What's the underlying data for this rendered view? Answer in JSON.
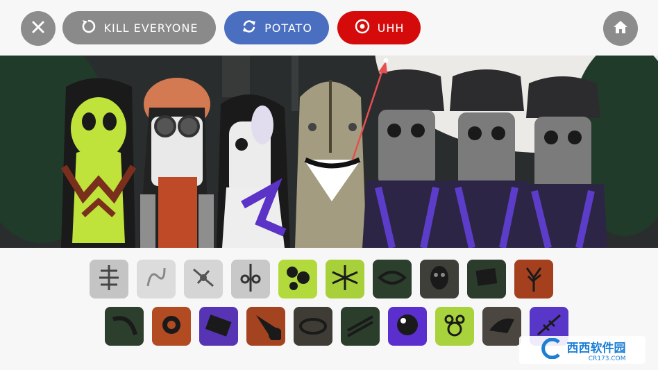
{
  "topbar": {
    "close_icon": "close-icon",
    "buttons": [
      {
        "label": "KILL EVERYONE",
        "icon": "reload-icon",
        "color": "#8a8a8a"
      },
      {
        "label": "POTATO",
        "icon": "refresh-icon",
        "color": "#4a6fc1"
      },
      {
        "label": "UHH",
        "icon": "record-icon",
        "color": "#d50a0a"
      }
    ],
    "home_icon": "home-icon"
  },
  "stage": {
    "characters": [
      {
        "name": "green-skeleton"
      },
      {
        "name": "brain-head"
      },
      {
        "name": "white-hair"
      },
      {
        "name": "burlap-sack"
      },
      {
        "name": "purple-hood-1"
      },
      {
        "name": "purple-hood-2"
      },
      {
        "name": "purple-hood-3"
      }
    ]
  },
  "palette": {
    "row1": [
      {
        "icon": "spine-icon",
        "bg": "#c4c4c4"
      },
      {
        "icon": "scribble-icon",
        "bg": "#dcdcdc"
      },
      {
        "icon": "dancer-icon",
        "bg": "#d5d5d5"
      },
      {
        "icon": "totem-icon",
        "bg": "#c8c8c8"
      },
      {
        "icon": "blob-icon",
        "bg": "#b2da3c"
      },
      {
        "icon": "tangle-icon",
        "bg": "#a8d03a"
      },
      {
        "icon": "eye-icon",
        "bg": "#2b3f2c"
      },
      {
        "icon": "mask-icon",
        "bg": "#3f3f3a"
      },
      {
        "icon": "box-icon",
        "bg": "#2c3c2c"
      },
      {
        "icon": "tree-icon",
        "bg": "#a5401f"
      }
    ],
    "row2": [
      {
        "icon": "hook-icon",
        "bg": "#2c3e2c"
      },
      {
        "icon": "target-icon",
        "bg": "#b24a22"
      },
      {
        "icon": "walkie-icon",
        "bg": "#5634b3"
      },
      {
        "icon": "drop-icon",
        "bg": "#a4431f"
      },
      {
        "icon": "rope-icon",
        "bg": "#3e3c34"
      },
      {
        "icon": "slash-icon",
        "bg": "#2b3e2b"
      },
      {
        "icon": "moon-icon",
        "bg": "#5b2fcd"
      },
      {
        "icon": "dots-icon",
        "bg": "#a8d33c"
      },
      {
        "icon": "horn-icon",
        "bg": "#4b4740"
      },
      {
        "icon": "fishbone-icon",
        "bg": "#5836c8"
      }
    ]
  },
  "watermark": {
    "main": "西西软件园",
    "sub": "CR173.COM"
  }
}
